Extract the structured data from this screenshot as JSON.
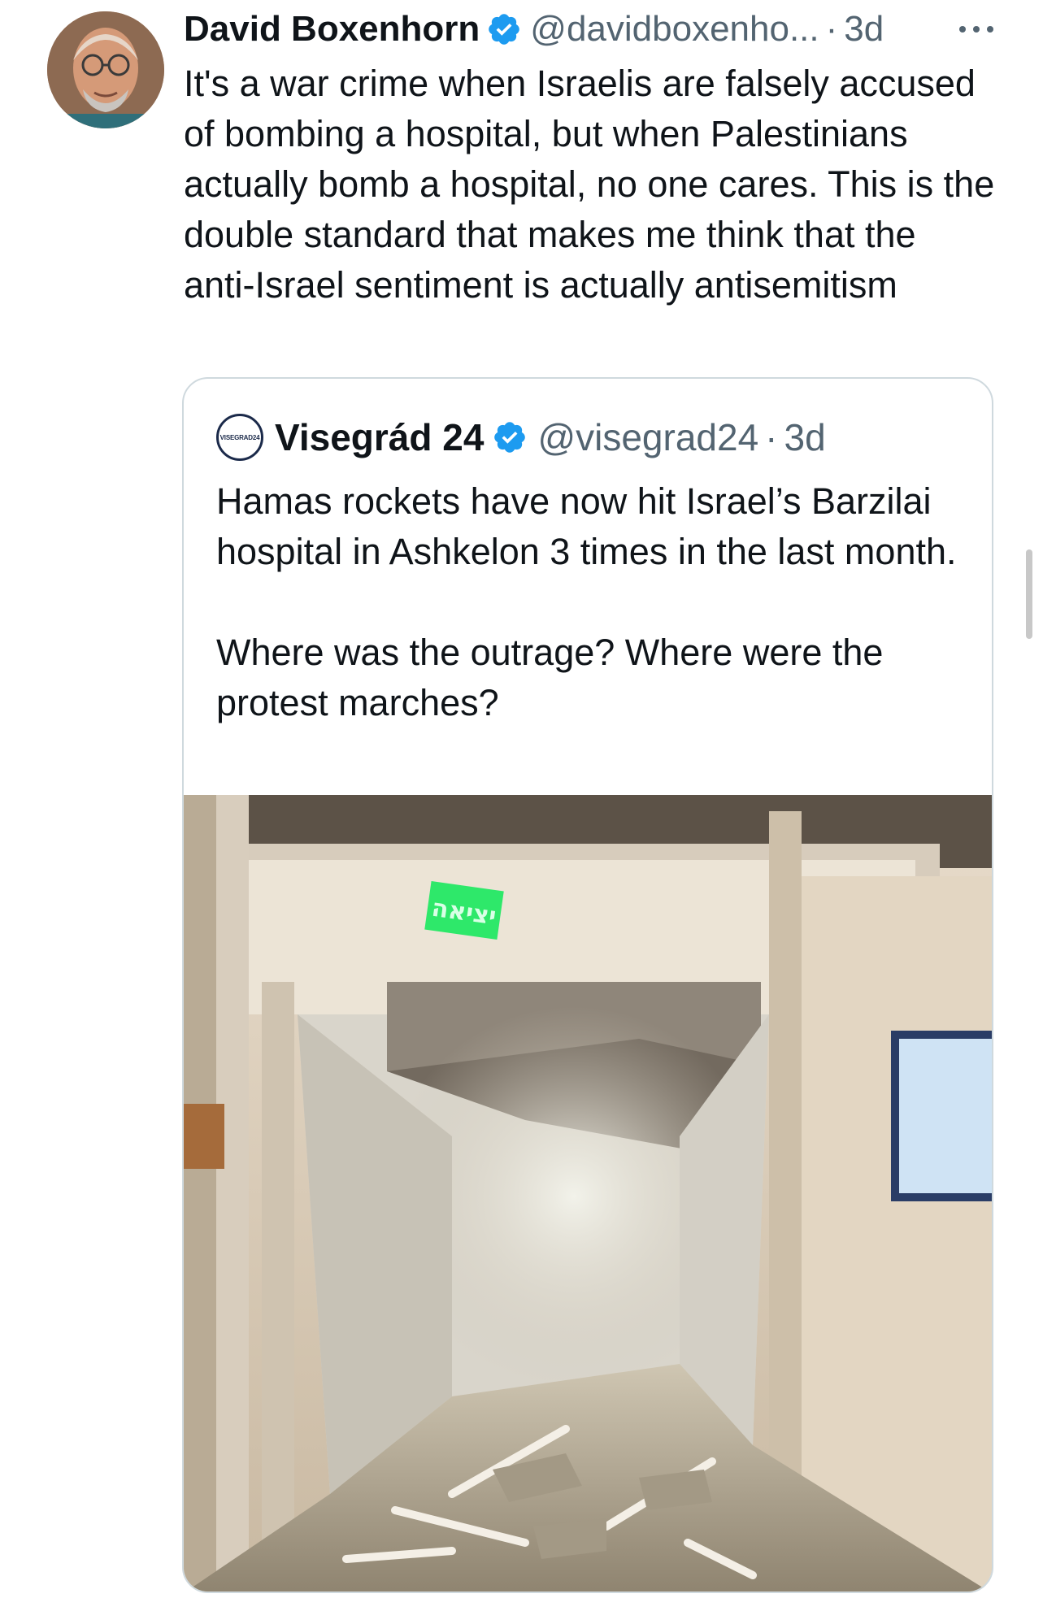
{
  "tweet": {
    "author_name": "David Boxenhorn",
    "handle": "@davidboxenho...",
    "separator": "·",
    "time": "3d",
    "text": "It's a war crime when Israelis are falsely accused of bombing a hospital, but when Palestinians actually bomb a hospital, no one cares. This is the double standard that makes me think that the anti-Israel sentiment is actually antisemitism",
    "more_icon": "more-horizontal-icon",
    "verified_icon": "verified-badge-icon"
  },
  "quote": {
    "logo_text": "VISEGRAD24",
    "author_name": "Visegrád 24",
    "handle": "@visegrad24",
    "separator": "·",
    "time": "3d",
    "paragraph1": "Hamas rockets have now hit Israel’s Barzilai hospital in Ashkelon 3 times in the last month.",
    "paragraph2": "Where was the outrage? Where were the protest marches?",
    "image_sign_text": "יציאה"
  },
  "colors": {
    "text": "#0f1419",
    "secondary": "#536471",
    "verified": "#1d9bf0",
    "border": "#cfd9de",
    "exit_sign": "#2ee86a"
  }
}
